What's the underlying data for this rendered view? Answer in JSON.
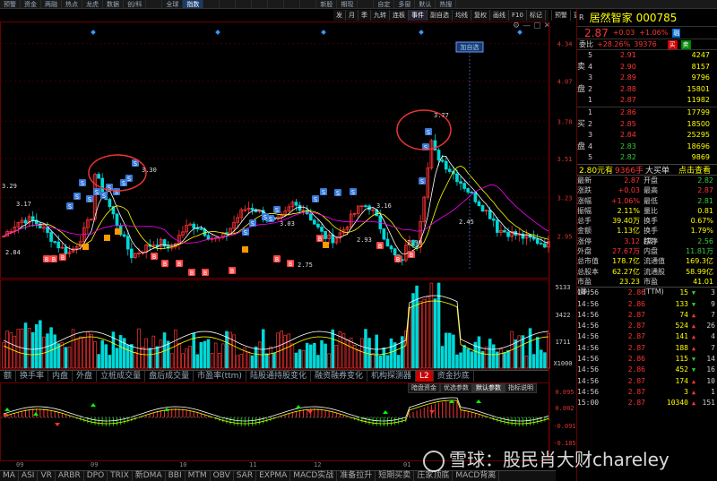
{
  "topbar": [
    "预警",
    "资金",
    "两融",
    "热点",
    "龙虎",
    "数据",
    "创/科",
    "",
    "全球",
    "指数",
    "",
    "",
    "",
    "",
    "",
    "",
    "",
    "新股",
    "期现",
    "",
    "自定",
    "多窗",
    "默认",
    "热搜"
  ],
  "toolbar2": [
    "发",
    "月",
    "季",
    "九转",
    "连板",
    "事件",
    "副自选",
    "均线",
    "复权",
    "画线",
    "F10",
    "标记",
    "",
    "预警",
    "更多"
  ],
  "stock": {
    "mark": "R",
    "name": "居然智家",
    "code": "000785",
    "price": "2.87",
    "change": "+0.03",
    "change_pct": "+1.06%",
    "tag": "融",
    "wb_label": "委比",
    "wb_pct": "+28.26%",
    "wb_diff": "39376",
    "wb_btn1": "买",
    "wb_btn2": "卖"
  },
  "order_book": {
    "sell_label": [
      "卖",
      "盘"
    ],
    "buy_label": [
      "买",
      "盘"
    ],
    "asks": [
      {
        "lv": "5",
        "price": "2.91",
        "vol": "4247"
      },
      {
        "lv": "4",
        "price": "2.90",
        "vol": "8157"
      },
      {
        "lv": "3",
        "price": "2.89",
        "vol": "9796"
      },
      {
        "lv": "2",
        "price": "2.88",
        "vol": "15801"
      },
      {
        "lv": "1",
        "price": "2.87",
        "vol": "11982"
      }
    ],
    "bids": [
      {
        "lv": "1",
        "price": "2.86",
        "vol": "17799"
      },
      {
        "lv": "2",
        "price": "2.85",
        "vol": "18500"
      },
      {
        "lv": "3",
        "price": "2.84",
        "vol": "25295"
      },
      {
        "lv": "4",
        "price": "2.83",
        "vol": "18696"
      },
      {
        "lv": "5",
        "price": "2.82",
        "vol": "9869"
      }
    ]
  },
  "big_order": {
    "price": "2.80元有",
    "vol": "9366手",
    "label": "大买单",
    "link": "点击查看"
  },
  "stats": [
    {
      "k": "最新",
      "v": "2.87",
      "vc": "up",
      "k2": "开盘",
      "v2": "2.82",
      "v2c": "dn"
    },
    {
      "k": "涨跌",
      "v": "+0.03",
      "vc": "up",
      "k2": "最高",
      "v2": "2.87",
      "v2c": "up"
    },
    {
      "k": "涨幅",
      "v": "+1.06%",
      "vc": "up",
      "k2": "最低",
      "v2": "2.81",
      "v2c": "dn"
    },
    {
      "k": "振幅",
      "v": "2.11%",
      "vc": "yel",
      "k2": "量比",
      "v2": "0.81",
      "v2c": "yel"
    },
    {
      "k": "总手",
      "v": "39.40万",
      "vc": "yel",
      "k2": "换手",
      "v2": "0.67%",
      "v2c": "yel"
    },
    {
      "k": "金额",
      "v": "1.13亿",
      "vc": "yel",
      "k2": "换手(实)",
      "v2": "1.79%",
      "v2c": "yel"
    },
    {
      "k": "涨停",
      "v": "3.12",
      "vc": "up",
      "k2": "跌停",
      "v2": "2.56",
      "v2c": "dn"
    },
    {
      "k": "外盘",
      "v": "27.67万",
      "vc": "up",
      "k2": "内盘",
      "v2": "11.81万",
      "v2c": "dn"
    },
    {
      "k": "总市值",
      "v": "178.7亿",
      "vc": "yel",
      "k2": "流通值",
      "v2": "169.3亿",
      "v2c": "yel"
    },
    {
      "k": "总股本",
      "v": "62.27亿",
      "vc": "yel",
      "k2": "流通股",
      "v2": "58.99亿",
      "v2c": "yel"
    },
    {
      "k": "市盈(静)",
      "v": "23.23",
      "vc": "yel",
      "k2": "市盈(TTM)",
      "v2": "41.01",
      "v2c": "yel"
    }
  ],
  "ticks": [
    {
      "t": "14:56",
      "p": "2.86",
      "pc": "up",
      "v": "15",
      "d": "dn",
      "n": "3"
    },
    {
      "t": "14:56",
      "p": "2.86",
      "pc": "up",
      "v": "133",
      "d": "dn",
      "n": "9"
    },
    {
      "t": "14:56",
      "p": "2.87",
      "pc": "up",
      "v": "74",
      "d": "up",
      "n": "7"
    },
    {
      "t": "14:56",
      "p": "2.87",
      "pc": "up",
      "v": "524",
      "d": "up",
      "n": "26"
    },
    {
      "t": "14:56",
      "p": "2.87",
      "pc": "up",
      "v": "141",
      "d": "up",
      "n": "4"
    },
    {
      "t": "14:56",
      "p": "2.87",
      "pc": "up",
      "v": "188",
      "d": "up",
      "n": "7"
    },
    {
      "t": "14:56",
      "p": "2.86",
      "pc": "up",
      "v": "115",
      "d": "dn",
      "n": "14"
    },
    {
      "t": "14:56",
      "p": "2.86",
      "pc": "up",
      "v": "452",
      "d": "dn",
      "n": "16"
    },
    {
      "t": "14:56",
      "p": "2.87",
      "pc": "up",
      "v": "174",
      "d": "up",
      "n": "10"
    },
    {
      "t": "14:56",
      "p": "2.87",
      "pc": "up",
      "v": "3",
      "d": "up",
      "n": "1"
    },
    {
      "t": "15:00",
      "p": "2.87",
      "pc": "up",
      "v": "10340",
      "d": "up",
      "n": "151"
    }
  ],
  "axis": {
    "price_ticks": [
      "4.34",
      "4.07",
      "3.78",
      "3.51",
      "3.23",
      "2.95"
    ],
    "vol_ticks": [
      "5133",
      "3422",
      "1711",
      "X1000"
    ],
    "macd_ticks": [
      "0.095",
      "0.002",
      "-0.091",
      "-0.185"
    ],
    "dates": [
      "09",
      "09",
      "10",
      "11",
      "12",
      "01"
    ]
  },
  "annotations": {
    "tag_box": "加自选",
    "lbl_329": "3.29",
    "lbl_317": "3.17",
    "lbl_284": "2.84",
    "lbl_330": "3.30",
    "lbl_377": "3.77",
    "lbl_303": "3.03",
    "lbl_275": "2.75",
    "lbl_293": "2.93",
    "lbl_316": "3.16",
    "lbl_290": "2.90",
    "lbl_245": "2.45"
  },
  "indicator_tabs": [
    "额",
    "换手率",
    "内盘",
    "外盘",
    "立桩成交量",
    "盘后成交量",
    "市盈率(ttm)",
    "陆股通持股变化",
    "融资融券变化",
    "机构探测器",
    "L2",
    "资金抄底"
  ],
  "macd_tabs": [
    "暗盘资金",
    "优选参数",
    "默认参数",
    "指标说明"
  ],
  "bottom_tabs": [
    "MA",
    "ASI",
    "VR",
    "ARBR",
    "DPO",
    "TRIX",
    "新DMA",
    "BBI",
    "MTM",
    "OBV",
    "SAR",
    "EXPMA",
    "MACD实战",
    "准备拉升",
    "短期买卖",
    "庄家顶底",
    "MACD背离"
  ],
  "watermark": "雪球：股民肖大财chareley",
  "colors": {
    "up": "#ff3333",
    "down": "#00cc00",
    "cyan": "#00c8c8",
    "yellow": "#ffff00",
    "accent": "#1a3a6a"
  }
}
